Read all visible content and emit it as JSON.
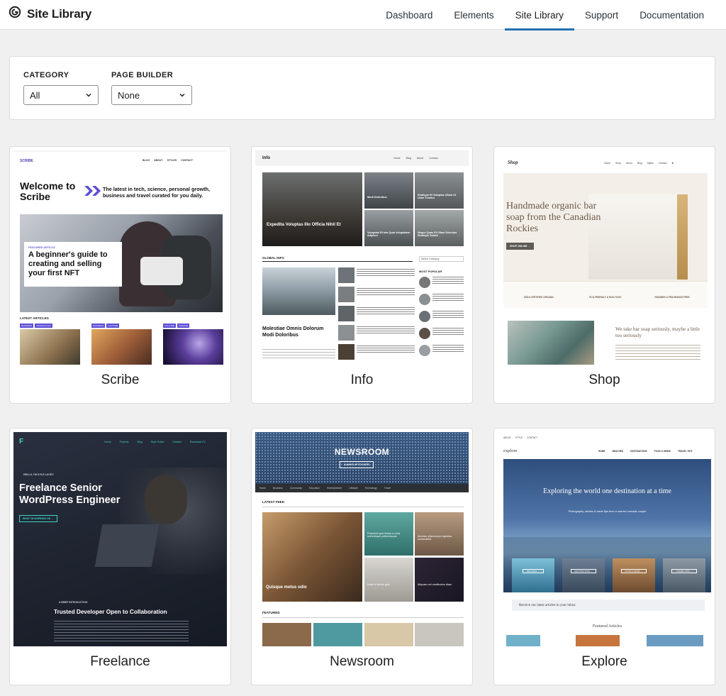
{
  "header": {
    "title": "Site Library",
    "nav": [
      {
        "label": "Dashboard",
        "active": false
      },
      {
        "label": "Elements",
        "active": false
      },
      {
        "label": "Site Library",
        "active": true
      },
      {
        "label": "Support",
        "active": false
      },
      {
        "label": "Documentation",
        "active": false
      }
    ]
  },
  "filters": {
    "category": {
      "label": "CATEGORY",
      "value": "All"
    },
    "page_builder": {
      "label": "PAGE BUILDER",
      "value": "None"
    }
  },
  "sites": [
    {
      "name": "Scribe",
      "preview": {
        "logo": "SCRIBE",
        "menu": [
          "BLOG",
          "ABOUT",
          "STYLES",
          "CONTACT"
        ],
        "headline": "Welcome to Scribe",
        "tagline": "The latest in tech, science, personal growth, business and travel curated for you daily.",
        "featured_tag": "FEATURED ARTICLE",
        "featured_title": "A beginner's guide to creating and selling your first NFT",
        "latest_label": "LATEST ARTICLES",
        "tags": [
          [
            "BUSINESS",
            "TECHNOLOGY"
          ],
          [
            "BUSINESS",
            "CULTURE"
          ],
          [
            "CULTURE",
            "SCIENCE"
          ]
        ]
      }
    },
    {
      "name": "Info",
      "preview": {
        "logo": "Info",
        "menu": [
          "Home",
          "Blog",
          "About",
          "Contact"
        ],
        "hero_title": "Expedita Voluptas Illo Officia Nihil Et",
        "side_titles": [
          "Modi Doloribus",
          "Sintlique Et Voluptas Ullam Ut Unde Tenetur",
          "Voluptate Et Iste Quia Voluptatem Adipisci",
          "Neque Quas Et Ullam Delectus Sintlique Soluta"
        ],
        "section": "GLOBAL INFO",
        "article_title": "Molestiae Omnis Dolorum Modi Doloribus",
        "select": "Select Category",
        "most_popular": "MOST POPULAR"
      }
    },
    {
      "name": "Shop",
      "preview": {
        "logo": "Shop",
        "menu": [
          "Home",
          "Shop",
          "About",
          "Blog",
          "Styles",
          "Contact"
        ],
        "headline": "Handmade organic bar soap from the Canadian Rockies",
        "button": "SHOP ONLINE →",
        "features": [
          "USDA CERTIFIED ORGANIC",
          "ECO-FRIENDLY & NON-TOXIC",
          "PARABEN & FRAGRANCE FREE"
        ],
        "subhead": "We take bar soap seriously, maybe a little too seriously"
      }
    },
    {
      "name": "Freelance",
      "preview": {
        "menu": [
          "Home",
          "Projects",
          "Blog",
          "Style Guide",
          "Contact",
          "Download CV"
        ],
        "hello": "HELLO, I'M KYLE LACEY",
        "headline": "Freelance Senior WordPress Engineer",
        "button": "WHAT I'M WORKING ON →",
        "intro_tag": "A BRIEF INTRODUCTION",
        "intro_title": "Trusted Developer Open to Collaboration"
      }
    },
    {
      "name": "Newsroom",
      "preview": {
        "title": "NEWSROOM",
        "button": "ALWAYS UP TO DATE!",
        "menu": [
          "Home",
          "Business",
          "Community",
          "Education",
          "Entertainment",
          "Lifestyle",
          "Technology",
          "Travel"
        ],
        "latest": "LATEST FEED",
        "featured": "FEATURED",
        "items": [
          "Quisque metus odio",
          "Praesent quis lectus a urna scelerisque pellentesque",
          "Aenean ullamcorper egestas consectetur",
          "Nulla id lectus quis",
          "Aliquam vel vestibulum diam"
        ]
      }
    },
    {
      "name": "Explore",
      "preview": {
        "top_links": [
          "ABOUT",
          "STYLE",
          "CONTACT"
        ],
        "logo": "explore",
        "menu": [
          "HOME",
          "BEACHES",
          "DESTINATIONS",
          "FOOD & DRINK",
          "TRAVEL TIPS"
        ],
        "headline": "Exploring the world one destination at a time",
        "subline": "Photography, articles & travel tips from a married nomadic couple",
        "buttons": [
          "BEACHES →",
          "DESTINATIONS →",
          "FOOD & DRINK →",
          "TRAVEL TIPS →"
        ],
        "newsletter": "Receive our latest articles in your inbox",
        "featured": "Featured Articles"
      }
    }
  ],
  "colors": {
    "accent": "#2271b1",
    "scribe_purple": "#6a5acd",
    "freelance_dark": "#1f2430",
    "newsroom_blue": "#3d5a80",
    "shop_cream": "#f6f2ec"
  }
}
